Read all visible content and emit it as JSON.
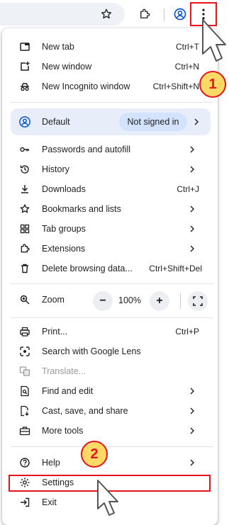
{
  "menu": {
    "new_tab": {
      "label": "New tab",
      "shortcut": "Ctrl+T"
    },
    "new_window": {
      "label": "New window",
      "shortcut": "Ctrl+N"
    },
    "new_incognito": {
      "label": "New Incognito window",
      "shortcut": "Ctrl+Shift+N"
    },
    "profile": {
      "label": "Default",
      "status": "Not signed in"
    },
    "passwords": {
      "label": "Passwords and autofill"
    },
    "history": {
      "label": "History"
    },
    "downloads": {
      "label": "Downloads",
      "shortcut": "Ctrl+J"
    },
    "bookmarks": {
      "label": "Bookmarks and lists"
    },
    "tab_groups": {
      "label": "Tab groups"
    },
    "extensions": {
      "label": "Extensions"
    },
    "delete_data": {
      "label": "Delete browsing data...",
      "shortcut": "Ctrl+Shift+Del"
    },
    "zoom": {
      "label": "Zoom",
      "minus": "−",
      "value": "100%",
      "plus": "+"
    },
    "print": {
      "label": "Print...",
      "shortcut": "Ctrl+P"
    },
    "lens": {
      "label": "Search with Google Lens"
    },
    "translate": {
      "label": "Translate..."
    },
    "find_edit": {
      "label": "Find and edit"
    },
    "cast_save": {
      "label": "Cast, save, and share"
    },
    "more_tools": {
      "label": "More tools"
    },
    "help": {
      "label": "Help"
    },
    "settings": {
      "label": "Settings"
    },
    "exit": {
      "label": "Exit"
    }
  },
  "annotations": {
    "step1": "1",
    "step2": "2"
  },
  "colors": {
    "highlight": "#e8141c",
    "badge_fill": "#ffd966",
    "profile_bg": "#e7eefa"
  }
}
